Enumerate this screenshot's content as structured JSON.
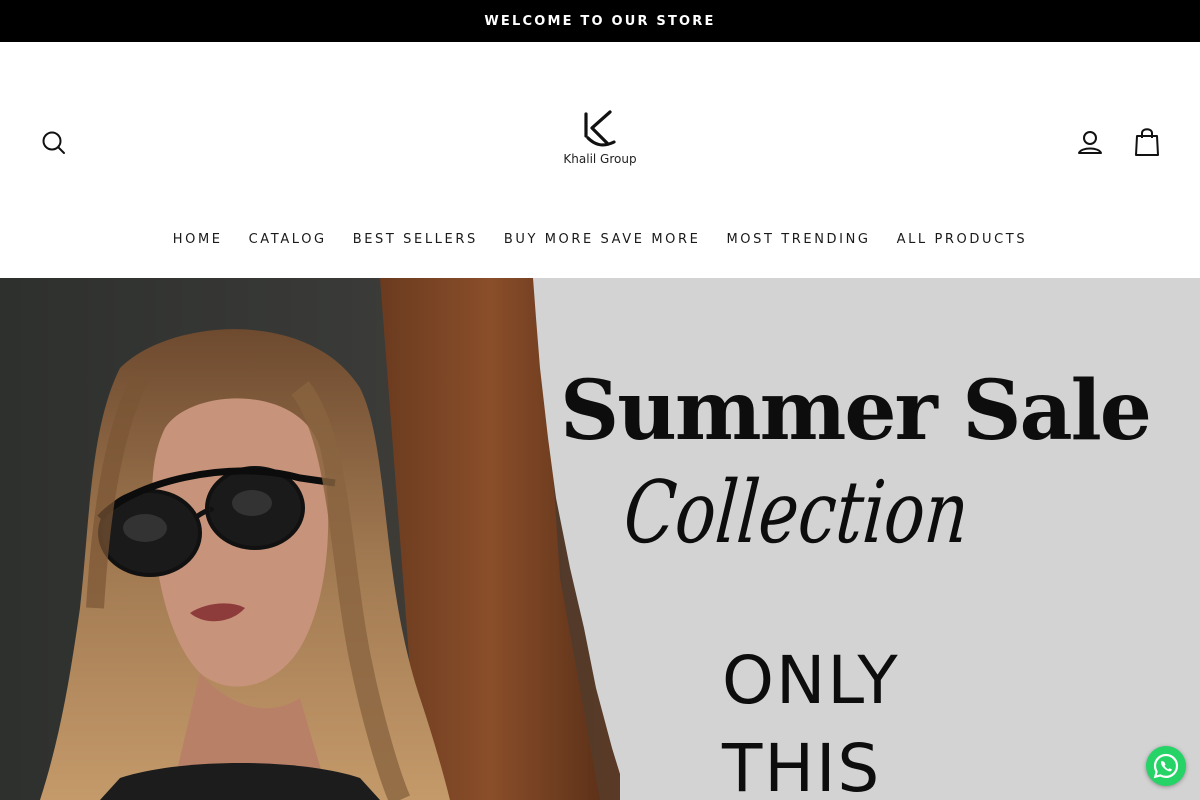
{
  "announcement": {
    "text": "WELCOME TO OUR STORE"
  },
  "header": {
    "logo_text": "Khalil Group",
    "icons": {
      "search": "search-icon",
      "account": "user-icon",
      "cart": "shopping-bag-icon"
    }
  },
  "nav": {
    "items": [
      {
        "label": "HOME"
      },
      {
        "label": "CATALOG"
      },
      {
        "label": "BEST SELLERS"
      },
      {
        "label": "BUY MORE SAVE MORE"
      },
      {
        "label": "MOST TRENDING"
      },
      {
        "label": "ALL PRODUCTS"
      }
    ]
  },
  "hero": {
    "title": "Summer Sale",
    "script": "Collection",
    "line1": "ONLY",
    "line2": "THIS"
  },
  "whatsapp": {
    "icon": "whatsapp-icon"
  },
  "colors": {
    "announcement_bg": "#000000",
    "hero_bg": "#d3d3d3",
    "whatsapp": "#25d366"
  }
}
